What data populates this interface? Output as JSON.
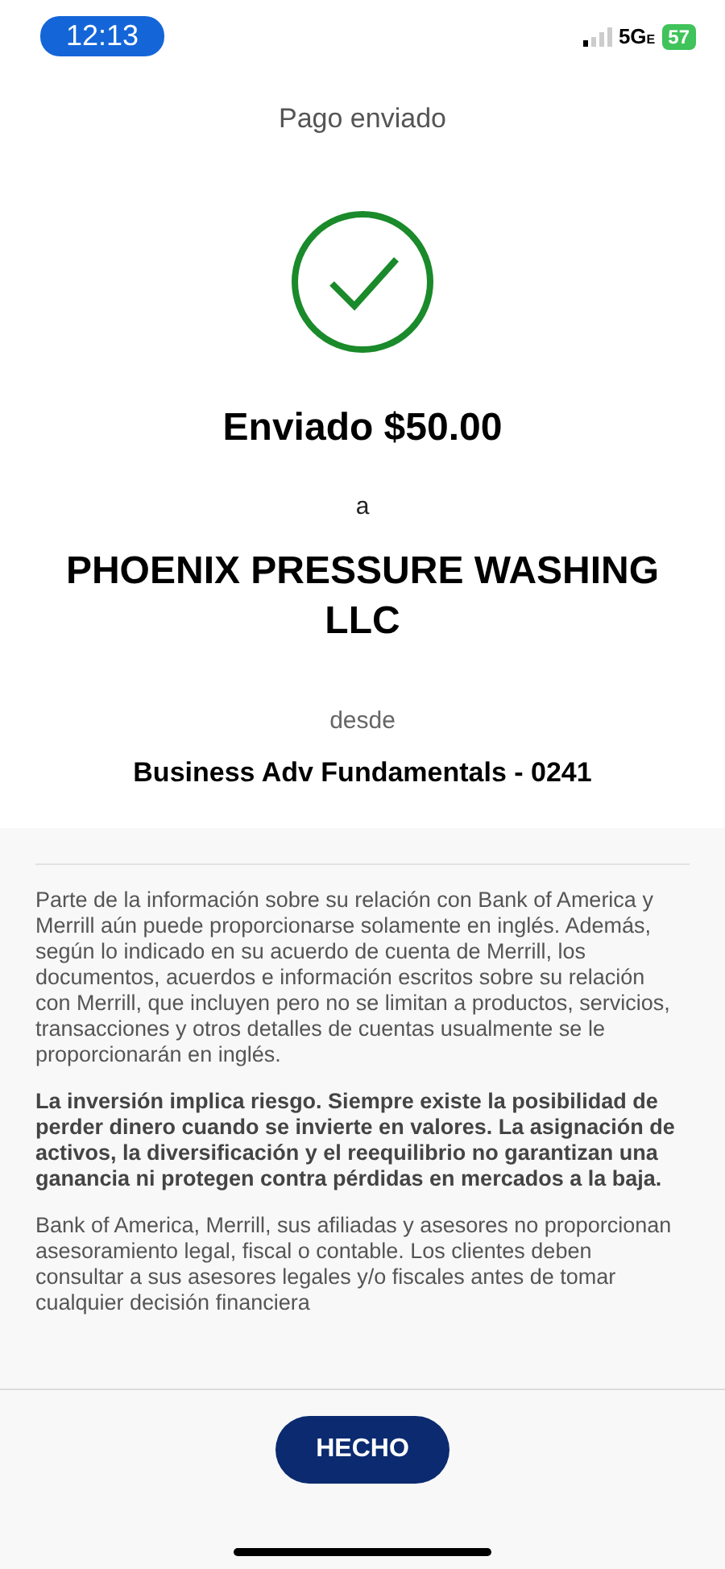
{
  "status_bar": {
    "time": "12:13",
    "network": "5G",
    "network_suffix": "E",
    "battery": "57"
  },
  "header": {
    "title": "Pago enviado"
  },
  "confirmation": {
    "amount_line": "Enviado $50.00",
    "to_label": "a",
    "recipient": "PHOENIX PRESSURE WASHING LLC",
    "from_label": "desde",
    "account": "Business Adv Fundamentals - 0241"
  },
  "disclosures": [
    {
      "text": "Parte de la información sobre su relación con Bank of America y Merrill aún puede proporcionarse solamente en inglés. Además, según lo indicado en su acuerdo de cuenta de Merrill, los documentos, acuerdos e información escritos sobre su relación con Merrill, que incluyen pero no se limitan a productos, servicios, transacciones y otros detalles de cuentas usualmente se le proporcionarán en inglés.",
      "bold": false
    },
    {
      "text": "La inversión implica riesgo. Siempre existe la posibilidad de perder dinero cuando se invierte en valores. La asignación de activos, la diversificación y el reequilibrio no garantizan una ganancia ni protegen contra pérdidas en mercados a la baja.",
      "bold": true
    },
    {
      "text": "Bank of America, Merrill, sus afiliadas y asesores no proporcionan asesoramiento legal, fiscal o contable. Los clientes deben consultar a sus asesores legales y/o fiscales antes de tomar cualquier decisión financiera",
      "bold": false
    }
  ],
  "done_button": "HECHO"
}
